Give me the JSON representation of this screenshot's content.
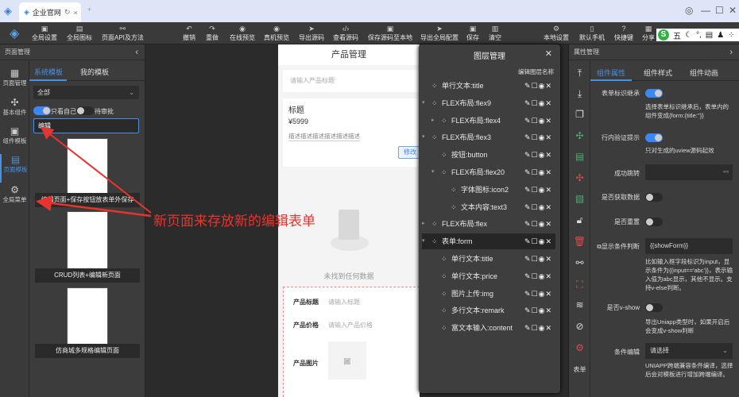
{
  "browser": {
    "tab_title": "企业官网",
    "new_tab": "+"
  },
  "toolbar": {
    "left": [
      "全局设置",
      "全局图标",
      "页面API及方法"
    ],
    "center": [
      "撤销",
      "重做",
      "在线预览",
      "真机预览",
      "导出源码",
      "查看源码",
      "保存源码至本地",
      "导出全局配置",
      "保存",
      "清空"
    ],
    "right": [
      "本地设置",
      "默认手机",
      "快捷键",
      "分享"
    ]
  },
  "ime": {
    "label": "五"
  },
  "left_panel": {
    "title": "页面管理",
    "nav": [
      "页面管理",
      "基本组件",
      "组件模板",
      "页面模板",
      "全局菜单"
    ],
    "tabs": [
      "系统模板",
      "我的模板"
    ],
    "category": "全部",
    "toggle_mine": "只看自己",
    "toggle_pending": "待审批",
    "search_value": "编辑",
    "templates": [
      "编辑页面+保存按钮放表单外保存",
      "CRUD列表+编辑新页面",
      "仿商城多规格编辑页面"
    ]
  },
  "annotation": {
    "text": "新页面来存放新的编辑表单",
    "color": "#e8332e"
  },
  "phone": {
    "title": "产品管理",
    "search_placeholder": "请输入产品标题",
    "card_title": "标题",
    "card_price": "¥5999",
    "card_desc": "描述描述描述描述描述描述",
    "edit_button": "修改",
    "empty_text": "未找到任何数据",
    "form": [
      {
        "label": "产品标题",
        "placeholder": "请输入标题"
      },
      {
        "label": "产品价格",
        "placeholder": "请输入产品价格"
      },
      {
        "label": "产品图片",
        "placeholder": ""
      }
    ]
  },
  "layers": {
    "title": "图层管理",
    "edit_names": "编辑图层名称",
    "actions": "✎☐◉✕",
    "rows": [
      {
        "label": "单行文本:title",
        "level": 0,
        "arrow": ""
      },
      {
        "label": "FLEX布局:flex9",
        "level": 0,
        "arrow": "▾"
      },
      {
        "label": "FLEX布局:flex4",
        "level": 1,
        "arrow": "▸"
      },
      {
        "label": "FLEX布局:flex3",
        "level": 0,
        "arrow": "▾"
      },
      {
        "label": "按钮:button",
        "level": 1,
        "arrow": ""
      },
      {
        "label": "FLEX布局:flex20",
        "level": 1,
        "arrow": "▾"
      },
      {
        "label": "字体图标:icon2",
        "level": 2,
        "arrow": ""
      },
      {
        "label": "文本内容:text3",
        "level": 2,
        "arrow": ""
      },
      {
        "label": "FLEX布局:flex",
        "level": 0,
        "arrow": "▸"
      },
      {
        "label": "表单:form",
        "level": 0,
        "arrow": "▾",
        "selected": true
      },
      {
        "label": "单行文本:title",
        "level": 1,
        "arrow": ""
      },
      {
        "label": "单行文本:price",
        "level": 1,
        "arrow": ""
      },
      {
        "label": "图片上传:img",
        "level": 1,
        "arrow": ""
      },
      {
        "label": "多行文本:remark",
        "level": 1,
        "arrow": ""
      },
      {
        "label": "富文本输入:content",
        "level": 1,
        "arrow": ""
      }
    ]
  },
  "right_panel": {
    "title": "属性管理",
    "tabs": [
      "组件属性",
      "组件样式",
      "组件动画"
    ],
    "side_label": "表单",
    "props": {
      "inherit": "表单标识继承",
      "inherit_desc": "选择表单标识继承后，表单内的组件变成{form:{title:''}}",
      "inline": "行内验证提示",
      "inline_desc": "只对生成的uview源码起效",
      "jump": "成功跳转",
      "fetch": "是否获取数据",
      "reset": "是否重置",
      "cond": "显示条件判断",
      "cond_value": "{{showForm}}",
      "cond_desc": "比如输入框字段标识为input，显示条件为{{input=='abc'}}，表示输入值为abc显示，其他不显示。支持v-else判断。",
      "vshow": "是否v-show",
      "vshow_desc": "导出Uniapp类型时，如果开启后会变成v-show判断",
      "compile": "条件编辑",
      "compile_value": "请选择",
      "compile_desc": "UNIAPP跨端兼容条件编译，选择后会对模板进行增加跨端编译。"
    }
  }
}
